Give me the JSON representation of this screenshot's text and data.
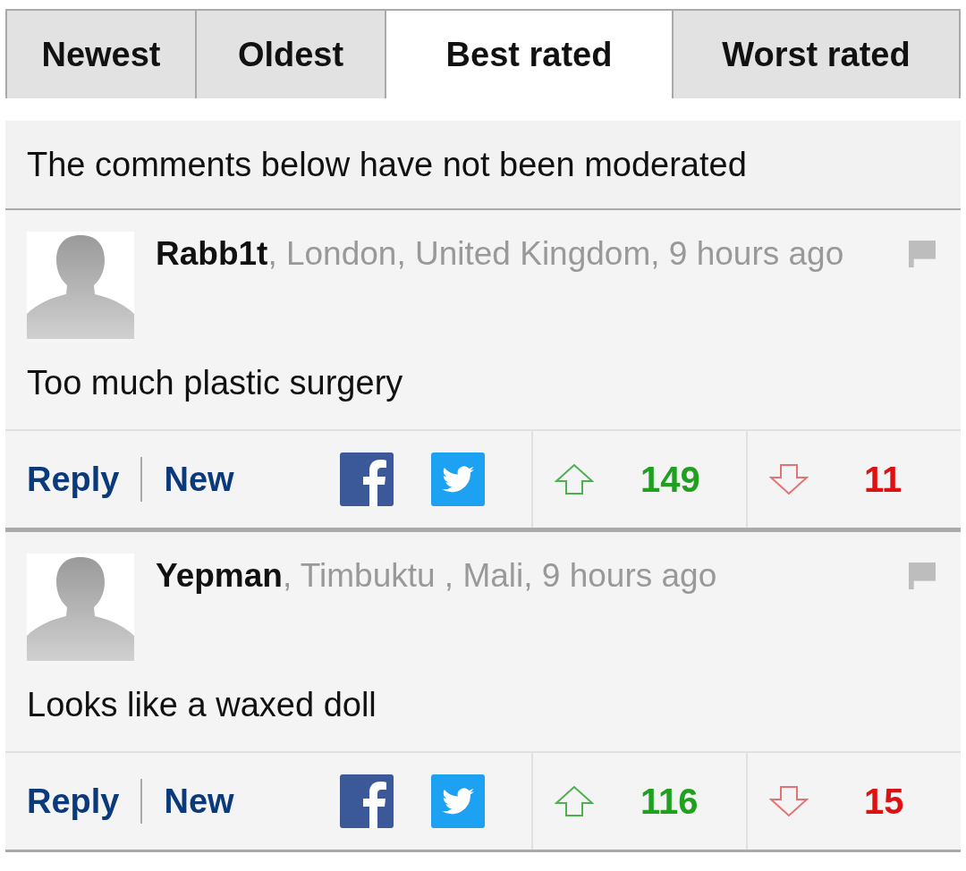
{
  "tabs": [
    {
      "label": "Newest",
      "selected": false
    },
    {
      "label": "Oldest",
      "selected": false
    },
    {
      "label": "Best rated",
      "selected": true
    },
    {
      "label": "Worst rated",
      "selected": false
    }
  ],
  "notice": "The comments below have not been moderated",
  "comments": [
    {
      "name": "Rabb1t",
      "meta": ", London, United Kingdom, 9 hours ago",
      "text": "Too much plastic surgery",
      "reply": "Reply",
      "new": "New",
      "up": "149",
      "down": "11"
    },
    {
      "name": "Yepman",
      "meta": ", Timbuktu , Mali, 9 hours ago",
      "text": "Looks like a waxed doll",
      "reply": "Reply",
      "new": "New",
      "up": "116",
      "down": "15"
    }
  ]
}
